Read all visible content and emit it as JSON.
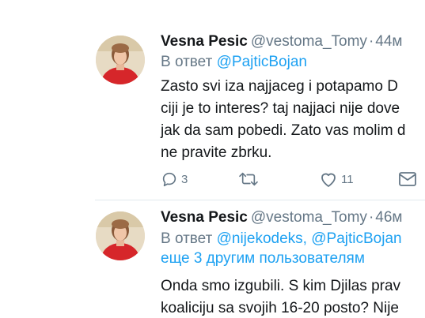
{
  "tweets": [
    {
      "display_name": "Vesna Pesic",
      "handle": "@vestoma_Tomy",
      "separator": "·",
      "time": "44м",
      "reply_prefix": "В ответ",
      "reply_to": "@PajticBojan",
      "lines": [
        "Zasto svi iza najjaceg i potapamo D",
        "ciji je to interes?  taj najjaci nije dove",
        "jak da sam pobedi. Zato vas molim d",
        "ne pravite zbrku."
      ],
      "actions": {
        "reply_count": "3",
        "retweet_count": "",
        "like_count": "11"
      }
    },
    {
      "display_name": "Vesna Pesic",
      "handle": "@vestoma_Tomy",
      "separator": "·",
      "time": "46м",
      "reply_prefix": "В ответ",
      "reply_to": "@nijekodeks, @PajticBojan",
      "reply_more": "еще 3 другим пользователям",
      "lines": [
        "Onda smo izgubili. S kim Djilas prav",
        "koaliciju sa svojih 16-20 posto? Nije"
      ]
    }
  ],
  "icons": {
    "reply": "reply-icon",
    "retweet": "retweet-icon",
    "like": "heart-icon",
    "dm": "envelope-icon"
  },
  "colors": {
    "link": "#1da1f2",
    "muted": "#657786",
    "text": "#14171a",
    "divider": "#e1e8ed"
  }
}
